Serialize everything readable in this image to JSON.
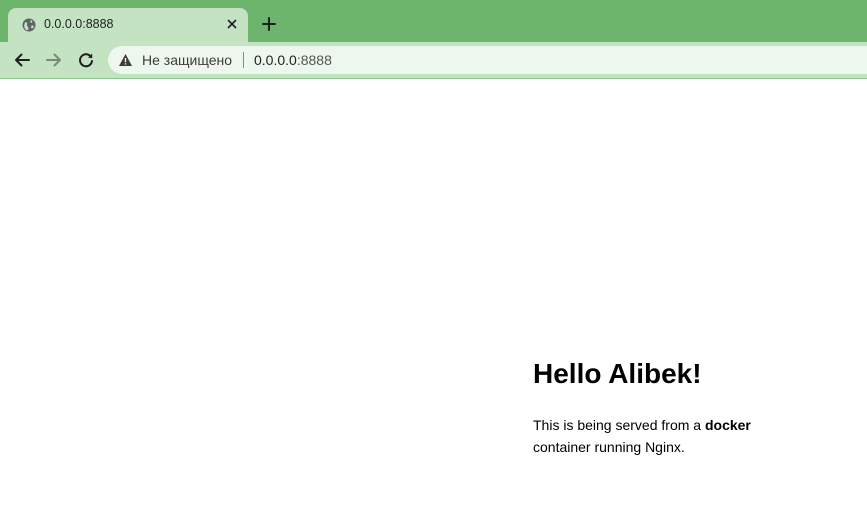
{
  "browser": {
    "tab": {
      "title": "0.0.0.0:8888",
      "favicon": "globe-icon",
      "close_icon": "close-icon"
    },
    "new_tab_icon": "plus-icon",
    "nav": {
      "back_icon": "back-arrow-icon",
      "forward_icon": "forward-arrow-icon",
      "reload_icon": "reload-icon"
    },
    "omnibox": {
      "security_icon": "warning-icon",
      "security_label": "Не защищено",
      "url_host": "0.0.0.0",
      "url_port": ":8888"
    },
    "colors": {
      "tabstrip": "#6db56d",
      "toolbar": "#c3e3c3",
      "omnibox": "#eef7ee"
    }
  },
  "page": {
    "heading": "Hello Alibek!",
    "paragraph": {
      "before": "This is being served from a ",
      "bold": "docker",
      "after": " container running Nginx."
    }
  }
}
